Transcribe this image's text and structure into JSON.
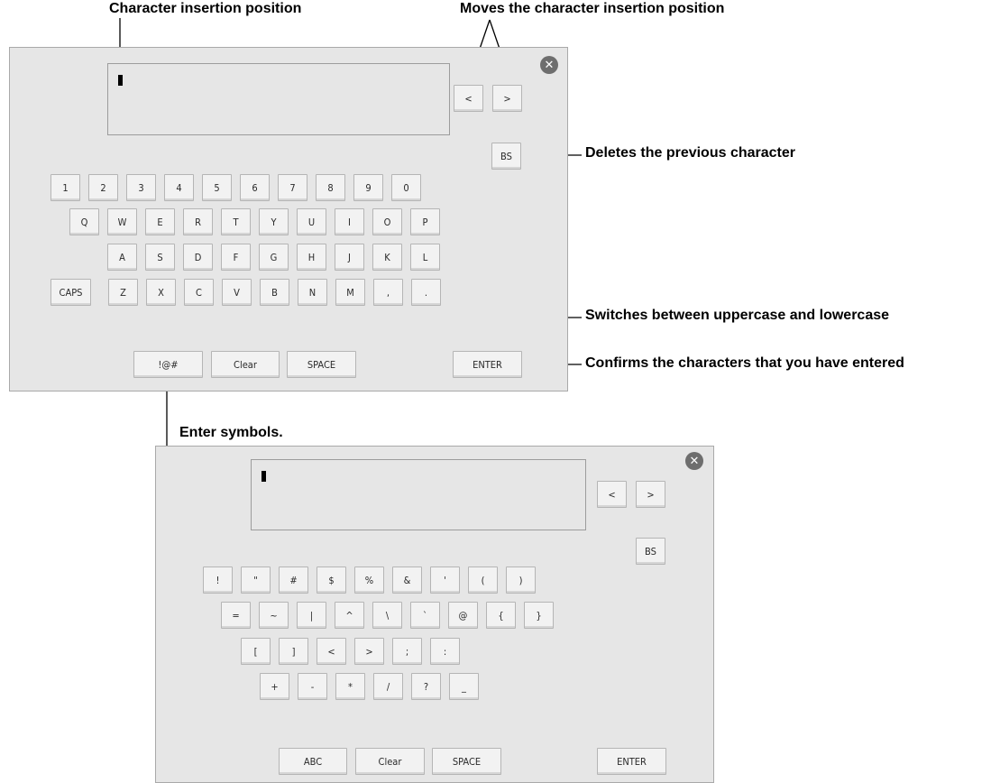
{
  "annotations": {
    "cursor_position": "Character insertion position",
    "move_cursor": "Moves the character insertion position",
    "backspace": "Deletes the previous character",
    "caps": "Switches between uppercase and lowercase",
    "enter": "Confirms the characters that you have entered",
    "symbols": "Enter symbols."
  },
  "keyboard_main": {
    "nav_left": "<",
    "nav_right": ">",
    "bs": "BS",
    "rows": [
      [
        "1",
        "2",
        "3",
        "4",
        "5",
        "6",
        "7",
        "8",
        "9",
        "0"
      ],
      [
        "Q",
        "W",
        "E",
        "R",
        "T",
        "Y",
        "U",
        "I",
        "O",
        "P"
      ],
      [
        "A",
        "S",
        "D",
        "F",
        "G",
        "H",
        "J",
        "K",
        "L"
      ],
      [
        "CAPS",
        "Z",
        "X",
        "C",
        "V",
        "B",
        "N",
        "M",
        ",",
        "."
      ]
    ],
    "symbol_key": "!@#",
    "clear": "Clear",
    "space": "SPACE",
    "enter": "ENTER"
  },
  "keyboard_symbols": {
    "nav_left": "<",
    "nav_right": ">",
    "bs": "BS",
    "rows": [
      [
        "!",
        "\"",
        "#",
        "$",
        "%",
        "&",
        "'",
        "(",
        ")"
      ],
      [
        "=",
        "~",
        "|",
        "^",
        "\\",
        "`",
        "@",
        "{",
        "}"
      ],
      [
        "[",
        "]",
        "<",
        ">",
        ";",
        ":"
      ],
      [
        "+",
        "-",
        "*",
        "/",
        "?",
        "_"
      ]
    ],
    "abc_key": "ABC",
    "clear": "Clear",
    "space": "SPACE",
    "enter": "ENTER"
  },
  "icons": {
    "close": "close-circle-icon"
  }
}
